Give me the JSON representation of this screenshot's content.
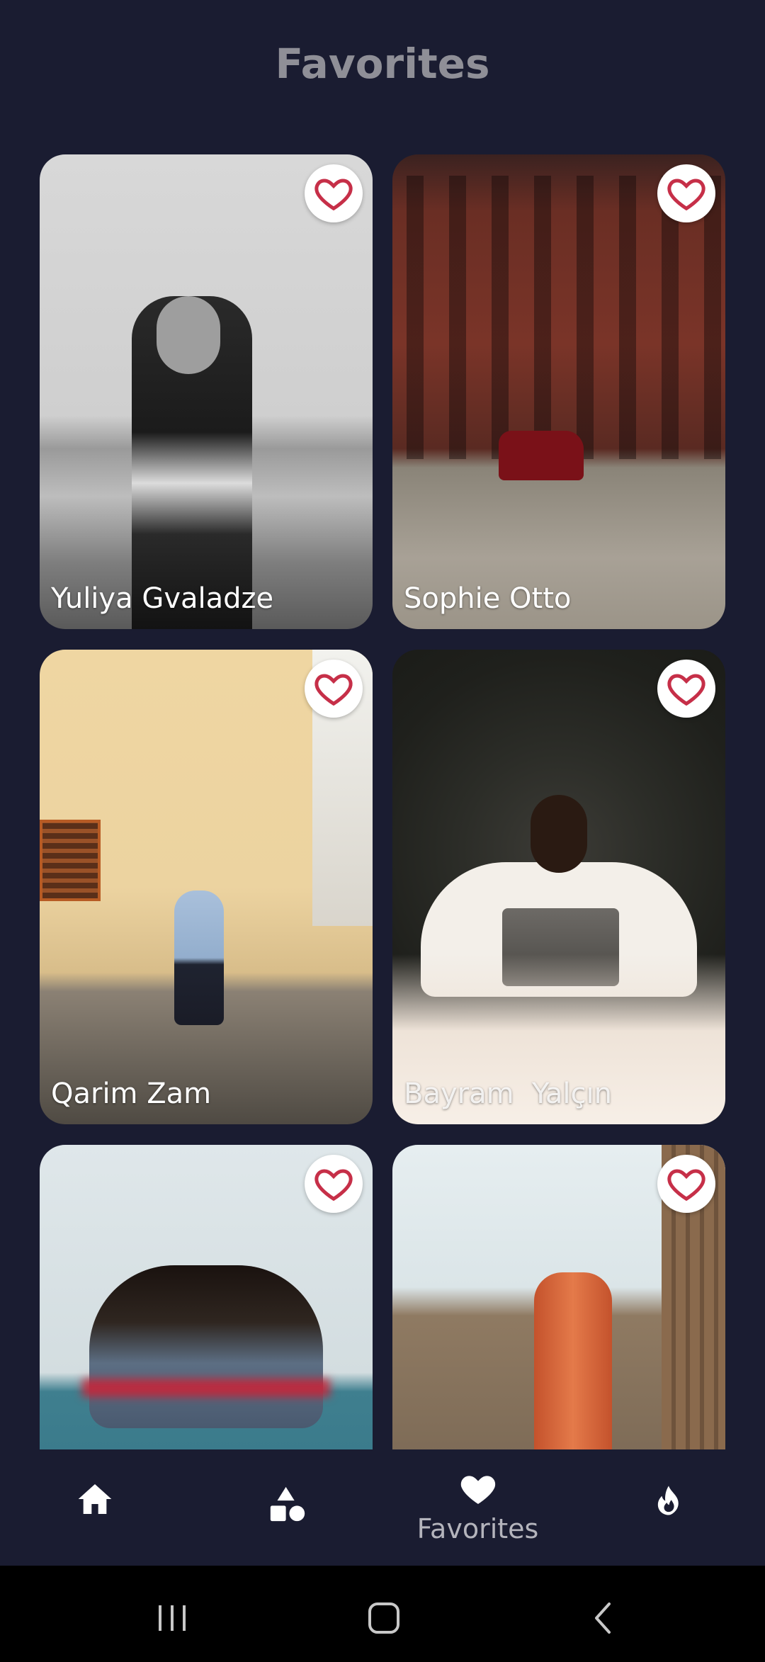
{
  "header": {
    "title": "Favorites"
  },
  "cards": [
    {
      "name": "Yuliya Gvaladze",
      "photo": "bw-portrait-beach",
      "favorited": true
    },
    {
      "name": "Sophie Otto",
      "photo": "brick-building-red-car",
      "favorited": true
    },
    {
      "name": "Qarim Zam",
      "photo": "woman-walking-yellow-wall",
      "favorited": true
    },
    {
      "name": "Bayram  Yalçın",
      "photo": "man-with-laptop",
      "favorited": true
    },
    {
      "name": "",
      "photo": "woman-by-sea",
      "favorited": true
    },
    {
      "name": "",
      "photo": "figure-in-ruins",
      "favorited": true
    }
  ],
  "bottom_nav": {
    "items": [
      {
        "icon": "home-icon",
        "label": ""
      },
      {
        "icon": "shapes-icon",
        "label": ""
      },
      {
        "icon": "heart-icon",
        "label": "Favorites",
        "active": true
      },
      {
        "icon": "fire-icon",
        "label": ""
      }
    ]
  },
  "colors": {
    "background": "#1a1c31",
    "heart": "#c62f48",
    "title": "#8f8f97"
  }
}
